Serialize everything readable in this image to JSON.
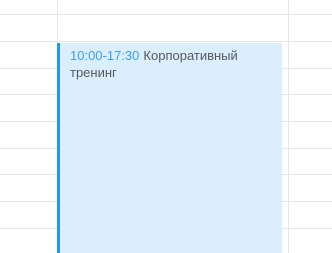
{
  "event": {
    "time": "10:00-17:30",
    "title": "Корпоративный тренинг"
  },
  "colors": {
    "event_background": "#dbeefd",
    "event_border": "#1a9bec",
    "time_text": "#3aa0e8",
    "title_text": "#555a60",
    "grid_line": "#e6e6e6"
  }
}
